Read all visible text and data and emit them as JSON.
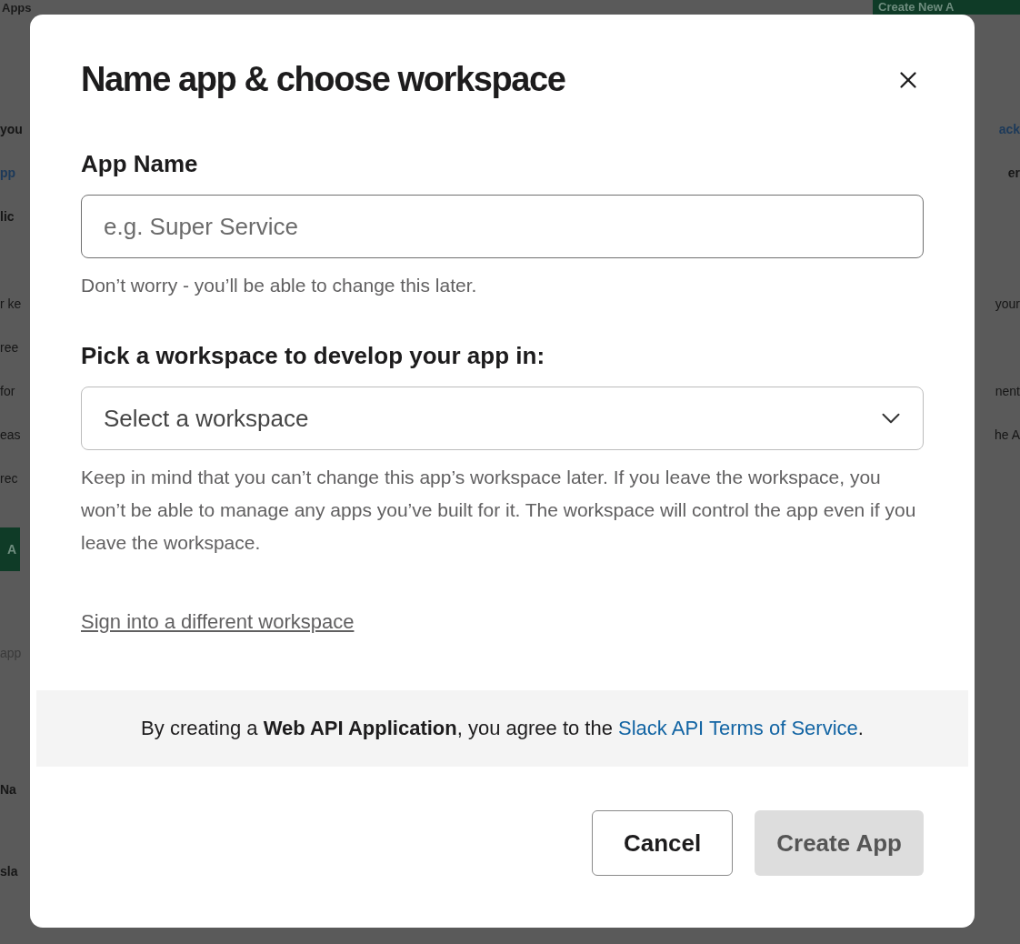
{
  "background": {
    "title": "Apps",
    "create_button": "Create New A",
    "left_fragments": [
      {
        "kind": "bold",
        "text": "you"
      },
      {
        "kind": "link",
        "text": "pp"
      },
      {
        "kind": "bold",
        "text": "lic"
      },
      {
        "kind": "plain",
        "text": "r ke"
      },
      {
        "kind": "plain",
        "text": "ree"
      },
      {
        "kind": "plain",
        "text": "for"
      },
      {
        "kind": "plain",
        "text": "eas"
      },
      {
        "kind": "plain",
        "text": "rec"
      },
      {
        "kind": "button",
        "text": "A"
      },
      {
        "kind": "placeholder",
        "text": "app"
      },
      {
        "kind": "bold",
        "text": "Na"
      },
      {
        "kind": "bold",
        "text": "sla"
      }
    ],
    "right_fragments": [
      {
        "kind": "link",
        "text": "ack"
      },
      {
        "kind": "bold",
        "text": "er"
      },
      {
        "kind": "plain",
        "text": "your"
      },
      {
        "kind": "plain",
        "text": "nent"
      },
      {
        "kind": "plain",
        "text": "he A"
      }
    ]
  },
  "dialog": {
    "title": "Name app & choose workspace",
    "app_name": {
      "label": "App Name",
      "placeholder": "e.g. Super Service",
      "hint": "Don’t worry - you’ll be able to change this later."
    },
    "workspace": {
      "label": "Pick a workspace to develop your app in:",
      "placeholder": "Select a workspace",
      "hint": "Keep in mind that you can’t change this app’s workspace later. If you leave the workspace, you won’t be able to manage any apps you’ve built for it. The workspace will control the app even if you leave the workspace."
    },
    "switch_link": "Sign into a different workspace",
    "terms": {
      "text": "By creating a **Web API Application**, you agree to the ",
      "link": "Slack API Terms of Service",
      "end": "."
    },
    "buttons": [
      {
        "kind": "secondary",
        "label": "Cancel",
        "disabled": false
      },
      {
        "kind": "primary",
        "label": "Create App",
        "disabled": true
      }
    ]
  }
}
